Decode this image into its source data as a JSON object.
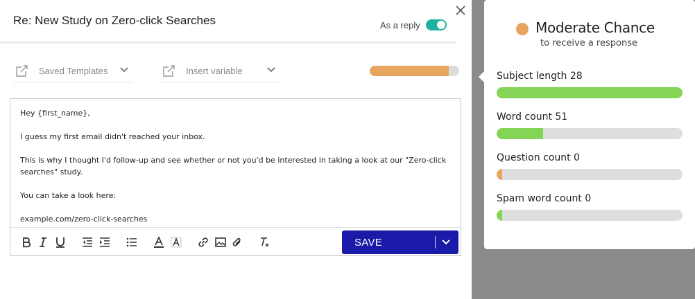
{
  "email": {
    "subject": "Re: New Study on Zero-click Searches",
    "reply_label": "As a reply",
    "reply_on": true,
    "templates_label": "Saved Templates",
    "variable_label": "Insert variable",
    "score_fraction": 0.88,
    "score_color": "#e8a55e",
    "body": {
      "greeting": "Hey {first_name},",
      "line1": "I guess my first email didn't reached your inbox.",
      "line2": "This is why I thought I'd follow-up and see whether or not you'd be interested in taking a look at our \"Zero-click searches\" study.",
      "line3": "You can take a look here:",
      "line4": "example.com/zero-click-searches"
    },
    "save_label": "SAVE",
    "toolbar_icons": [
      "bold-icon",
      "italic-icon",
      "underline-icon",
      "outdent-icon",
      "indent-icon",
      "list-icon",
      "font-color-icon",
      "highlight-icon",
      "link-icon",
      "image-icon",
      "attachment-icon",
      "clear-format-icon"
    ]
  },
  "panel": {
    "title": "Moderate Chance",
    "subtitle": "to receive a response",
    "dot_color": "#e8a55e",
    "metrics": [
      {
        "label": "Subject length 28",
        "fraction": 1.0,
        "color": "#84d456"
      },
      {
        "label": "Word count 51",
        "fraction": 0.25,
        "color": "#84d456"
      },
      {
        "label": "Question count 0",
        "fraction": 0.03,
        "color": "#e8a55e"
      },
      {
        "label": "Spam word count 0",
        "fraction": 0.03,
        "color": "#84d456"
      }
    ]
  },
  "colors": {
    "save_button": "#1a1aa8",
    "toggle": "#1bb3a0",
    "overlay": "#8a8a8a"
  }
}
